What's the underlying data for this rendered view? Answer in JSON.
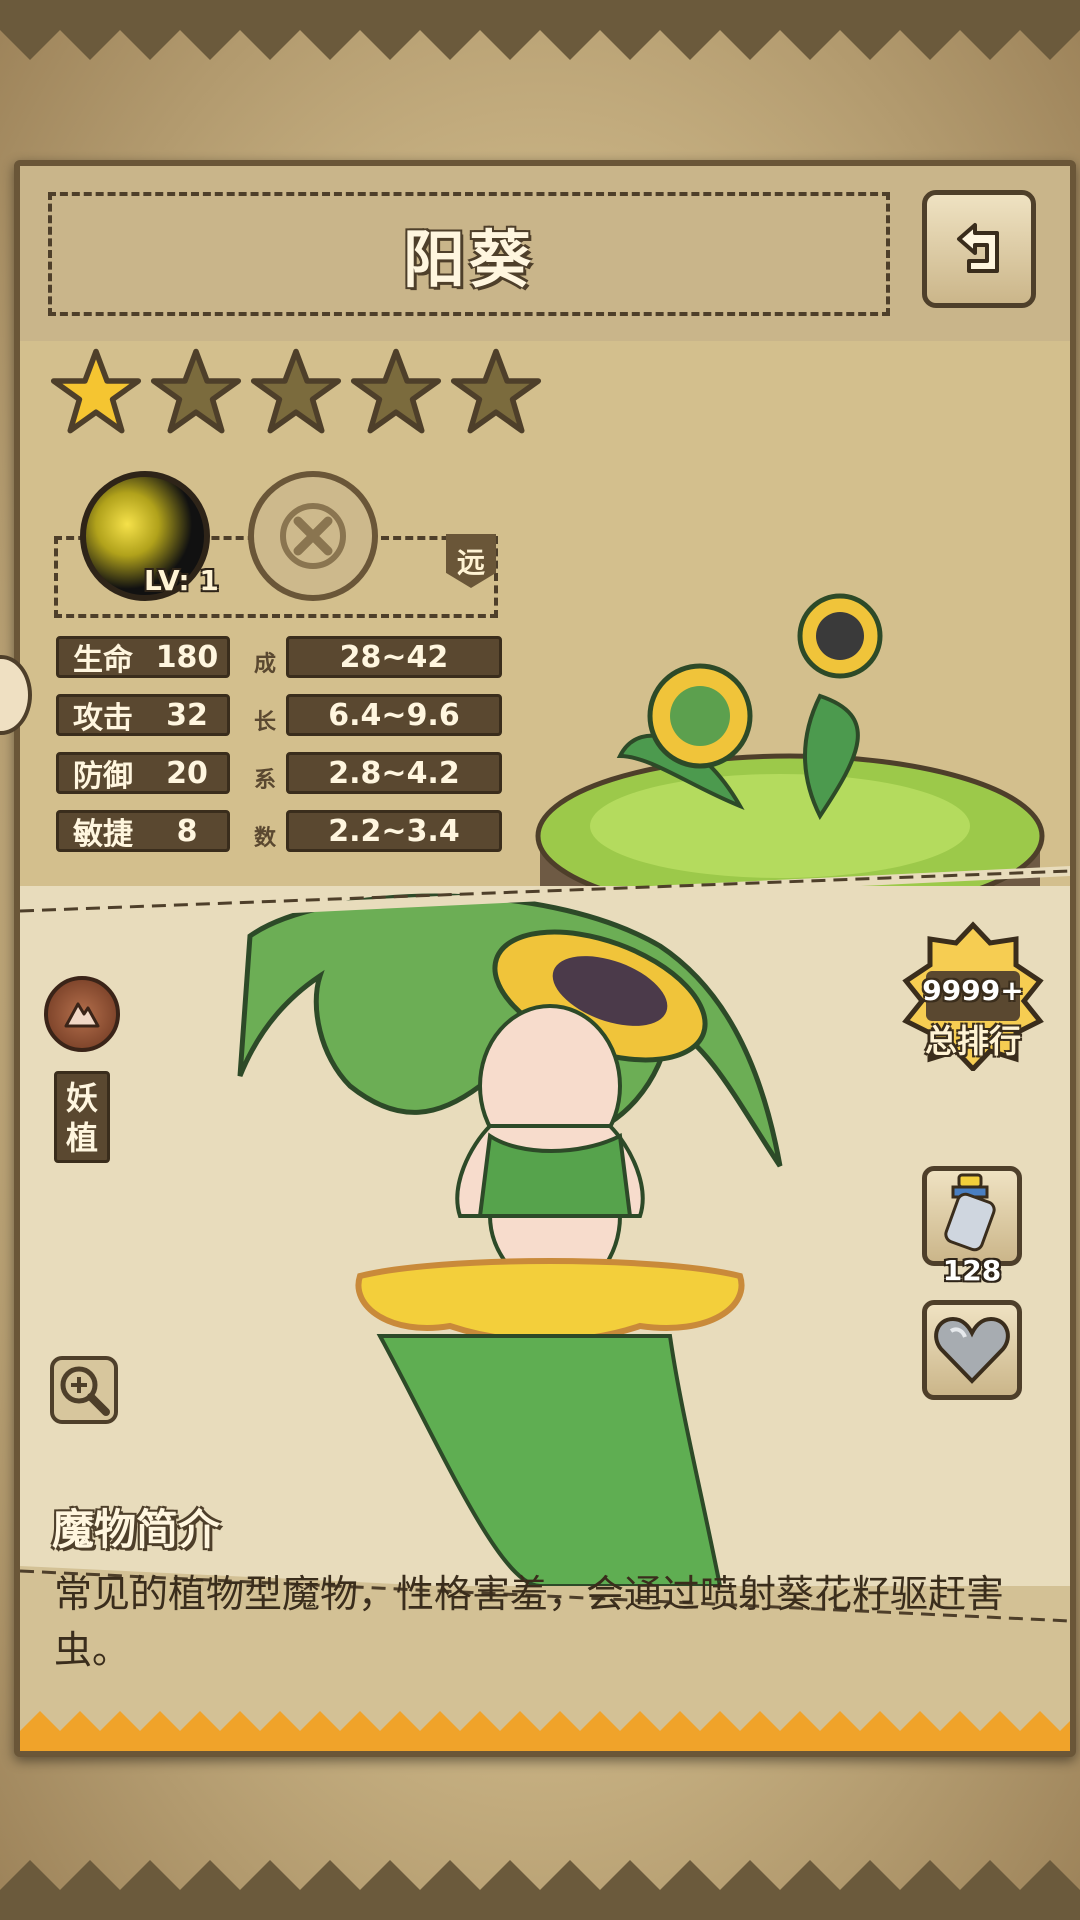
{
  "header": {
    "title": "阳葵"
  },
  "monster": {
    "star_rating": 1,
    "star_max": 5,
    "skill_level": "LV: 1",
    "range_tag": "远",
    "stats": [
      {
        "name": "生命",
        "value": "180",
        "growth": "28~42"
      },
      {
        "name": "攻击",
        "value": "32",
        "growth": "6.4~9.6"
      },
      {
        "name": "防御",
        "value": "20",
        "growth": "2.8~4.2"
      },
      {
        "name": "敏捷",
        "value": "8",
        "growth": "2.2~3.4"
      }
    ],
    "growth_label": [
      "成",
      "长",
      "系",
      "数"
    ],
    "type_label": "妖植"
  },
  "rank": {
    "value": "9999+",
    "label": "总排行"
  },
  "items": {
    "bottle_count": "128"
  },
  "description": {
    "title": "魔物简介",
    "text": "常见的植物型魔物，性格害羞，会通过喷射葵花籽驱赶害虫。"
  },
  "icons": {
    "back": "back-arrow-icon",
    "skill": "seed-spray-icon",
    "locked_skill": "locked-x-icon",
    "type": "plant-type-icon",
    "zoom": "zoom-in-icon",
    "bottle": "bottle-icon",
    "heart": "heart-stone-icon"
  },
  "colors": {
    "accent": "#5a4830",
    "gold_star": "#f2c12e",
    "empty_star": "#7b6b3d"
  }
}
